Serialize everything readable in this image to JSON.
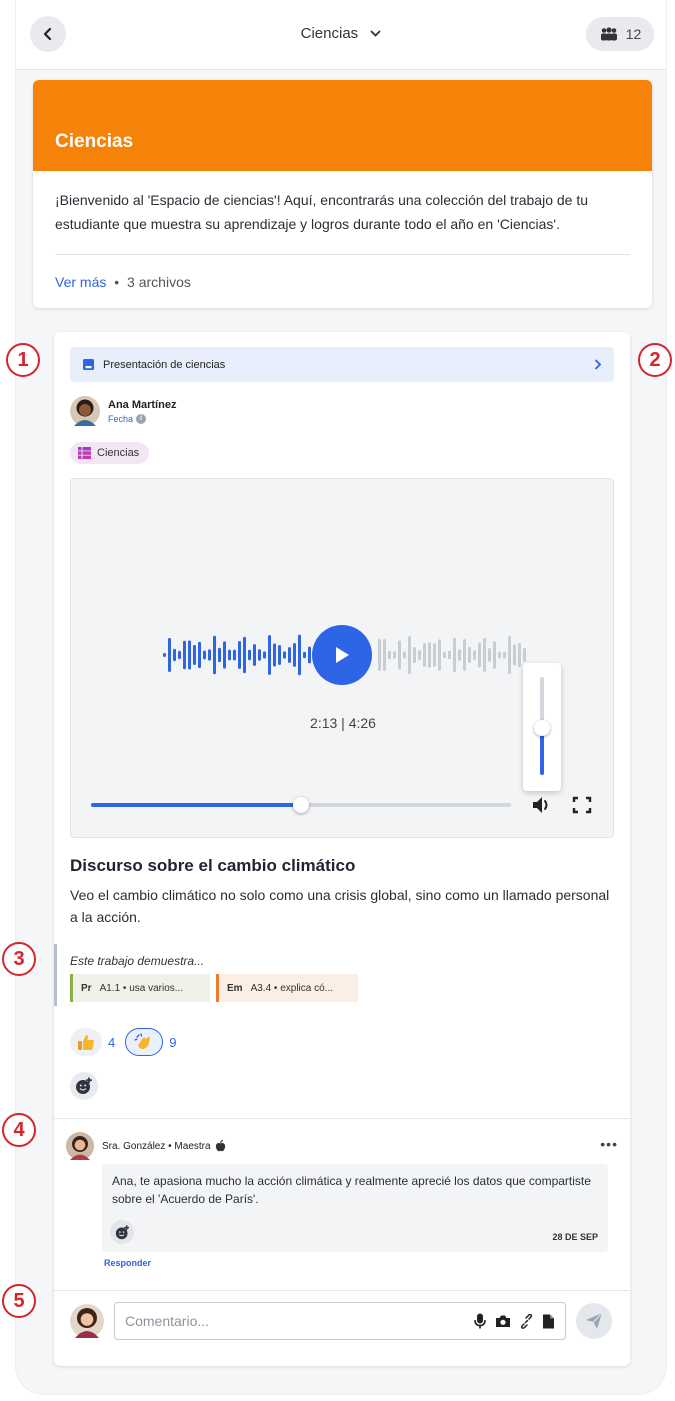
{
  "header": {
    "title": "Ciencias",
    "class_count": "12"
  },
  "space": {
    "banner_title": "Ciencias",
    "description": "¡Bienvenido al 'Espacio de ciencias'! Aquí, encontrarás una colección del trabajo de tu estudiante que muestra su aprendizaje y logros durante todo el año en 'Ciencias'.",
    "see_more": "Ver más",
    "separator": "•",
    "files": "3 archivos",
    "banner_color": "#f5830a"
  },
  "post": {
    "folder": "Presentación de ciencias",
    "author_name": "Ana Martínez",
    "author_date_label": "Fecha",
    "subject_tag": "Ciencias",
    "media": {
      "time_display": "2:13 | 4:26",
      "progress": 0.5,
      "volume": 0.48
    },
    "work_title": "Discurso sobre el cambio climático",
    "work_desc": "Veo el cambio climático no solo como una crisis global, sino como un llamado personal a la acción.",
    "demonstrates_label": "Este trabajo demuestra...",
    "standards": [
      {
        "code": "Pr",
        "text": "A1.1 • usa varios..."
      },
      {
        "code": "Em",
        "text": "A3.4 • explica có..."
      }
    ],
    "reactions": [
      {
        "icon": "thumbs-up",
        "count": "4"
      },
      {
        "icon": "clapping",
        "count": "9"
      }
    ]
  },
  "comment": {
    "author": "Sra. González • Maestra",
    "more": "•••",
    "text": "Ana, te apasiona mucho la acción climática y realmente aprecié los datos que compartiste sobre el 'Acuerdo de París'.",
    "date": "28 DE SEP",
    "reply": "Responder"
  },
  "composer": {
    "placeholder": "Comentario..."
  },
  "callouts": [
    "1",
    "2",
    "3",
    "4",
    "5"
  ],
  "colors": {
    "accent": "#2e64e6",
    "callout": "#d7232b"
  }
}
